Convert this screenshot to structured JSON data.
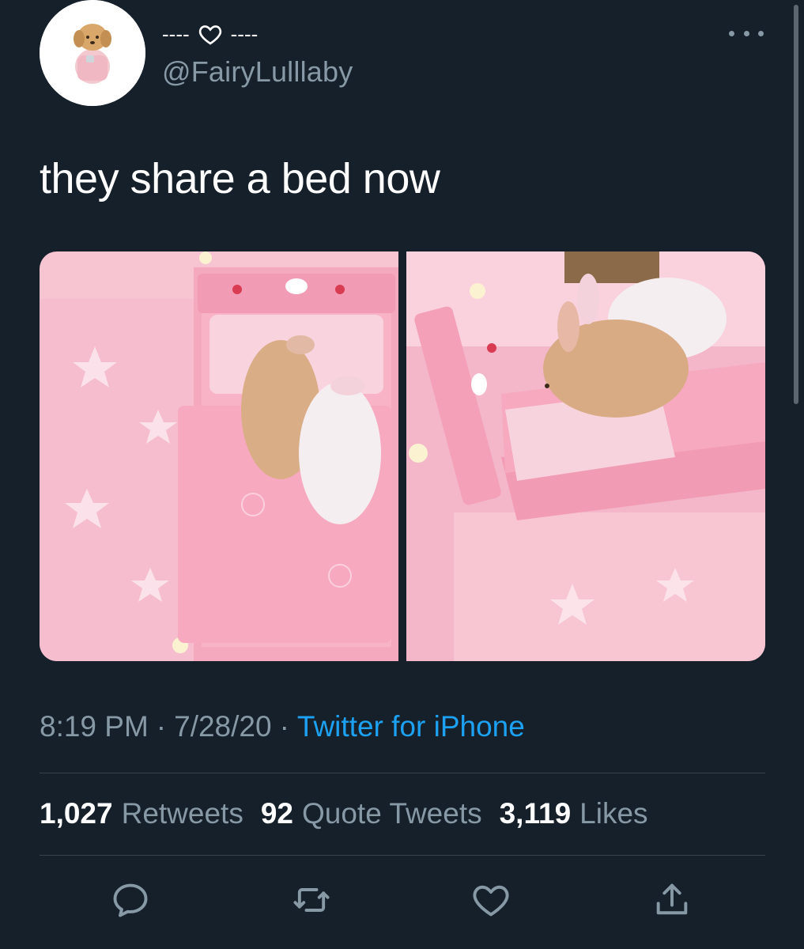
{
  "tweet": {
    "display_name_left": "----",
    "display_name_right": "----",
    "handle": "@FairyLulllaby",
    "text": "they share a bed now",
    "time": "8:19 PM",
    "date": "7/28/20",
    "source": "Twitter for iPhone"
  },
  "stats": {
    "retweets_count": "1,027",
    "retweets_label": "Retweets",
    "quotes_count": "92",
    "quotes_label": "Quote Tweets",
    "likes_count": "3,119",
    "likes_label": "Likes"
  },
  "colors": {
    "background": "#15202b",
    "secondary_text": "#8899a6",
    "link": "#1da1f2",
    "divider": "#38444d"
  },
  "icons": {
    "name_heart": "heart-outline-icon",
    "more": "more-dots-icon",
    "reply": "reply-icon",
    "retweet": "retweet-icon",
    "like": "heart-icon",
    "share": "share-icon"
  }
}
